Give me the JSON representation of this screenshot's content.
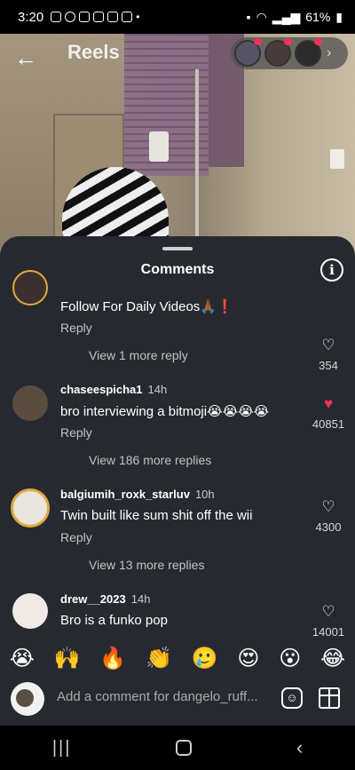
{
  "status_bar": {
    "time": "3:20",
    "battery": "61%"
  },
  "header": {
    "back": "←",
    "title": "Reels",
    "chevron": "›"
  },
  "sheet": {
    "title": "Comments",
    "info_glyph": "i"
  },
  "comments": [
    {
      "user": "",
      "time": "",
      "text": "Follow For Daily Videos🙏🏾❗",
      "reply": "Reply",
      "likes": "354",
      "liked": false,
      "view_replies": "View 1 more reply"
    },
    {
      "user": "chaseespicha1",
      "time": "14h",
      "text": "bro interviewing a bitmoji😭😭😭😭",
      "reply": "Reply",
      "likes": "40851",
      "liked": true,
      "view_replies": "View 186 more replies"
    },
    {
      "user": "balgiumih_roxk_starluv",
      "time": "10h",
      "text": "Twin built like sum shit off the wii",
      "reply": "Reply",
      "likes": "4300",
      "liked": false,
      "view_replies": "View 13 more replies"
    },
    {
      "user": "drew__2023",
      "time": "14h",
      "text": "Bro is a funko pop",
      "reply": "",
      "likes": "14001",
      "liked": false,
      "view_replies": ""
    }
  ],
  "emoji_bar": [
    "😭",
    "🙌",
    "🔥",
    "👏",
    "🥲",
    "😍",
    "😮",
    "😂"
  ],
  "composer": {
    "placeholder": "Add a comment for dangelo_ruff..."
  },
  "nav": {
    "recent": "|||",
    "back": "‹"
  },
  "colors": {
    "sheet_bg": "#262a30",
    "like_red": "#f2325a"
  }
}
